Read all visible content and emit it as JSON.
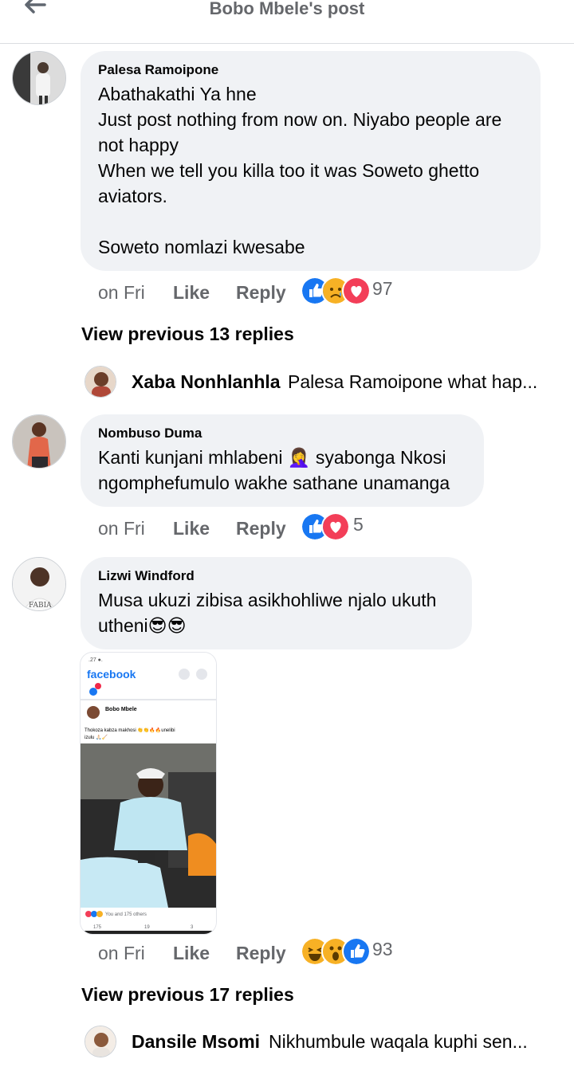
{
  "header": {
    "title": "Bobo Mbele's post"
  },
  "comments": [
    {
      "author": "Palesa Ramoipone",
      "text": "Abathakathi Ya hne\nJust post nothing from now on. Niyabo people are not happy\nWhen we tell you killa too it was Soweto ghetto aviators.\n\nSoweto nomlazi kwesabe",
      "time": "on Fri",
      "like": "Like",
      "reply": "Reply",
      "reaction_count": "97",
      "reactions": [
        "like",
        "sad",
        "love"
      ],
      "view_previous": "View previous 13 replies",
      "last_reply": {
        "name": "Xaba Nonhlanhla",
        "text": "Palesa Ramoipone what hap..."
      }
    },
    {
      "author": "Nombuso Duma",
      "text": "Kanti kunjani mhlabeni 🤦‍♀️ syabonga Nkosi ngomphefumulo wakhe sathane unamanga",
      "time": "on Fri",
      "like": "Like",
      "reply": "Reply",
      "reaction_count": "5",
      "reactions": [
        "like",
        "love"
      ]
    },
    {
      "author": "Lizwi Windford",
      "text": "Musa ukuzi zibisa asikhohliwe njalo ukuth utheni😎😎",
      "time": "on Fri",
      "like": "Like",
      "reply": "Reply",
      "reaction_count": "93",
      "reactions": [
        "haha",
        "wow",
        "like"
      ],
      "view_previous": "View previous 17 replies",
      "last_reply": {
        "name": "Dansile Msomi",
        "text": "Nikhumbule waqala kuphi sen..."
      },
      "attachment": {
        "app_name": "facebook",
        "post_author": "Bobo Mbele",
        "post_text": "Thokoza kabza makhosi 👏👏🔥🔥unelibi izulu 🙏🏻🧹",
        "reactions_text": "You and 175 others",
        "like_count": "175",
        "comment_count": "19",
        "share_count": "3"
      }
    }
  ],
  "colors": {
    "like_blue": "#1877f2",
    "love_red": "#f33e58",
    "reaction_yellow": "#f7b125",
    "text_secondary": "#65676b"
  }
}
